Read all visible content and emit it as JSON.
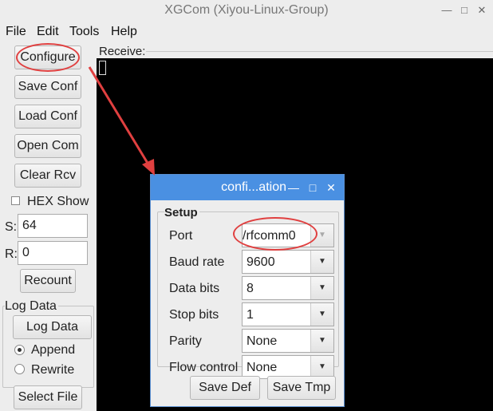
{
  "window": {
    "title": "XGCom (Xiyou-Linux-Group)"
  },
  "menu": [
    "File",
    "Edit",
    "Tools",
    "Help"
  ],
  "buttons": {
    "configure": "Configure",
    "save_conf": "Save Conf",
    "load_conf": "Load Conf",
    "open_com": "Open Com",
    "clear_rcv": "Clear Rcv",
    "recount": "Recount",
    "log_data": "Log Data",
    "select_file": "Select File"
  },
  "hex_show": {
    "label": "HEX Show",
    "checked": false
  },
  "counters": {
    "s_label": "S:",
    "s_value": "64",
    "r_label": "R:",
    "r_value": "0"
  },
  "log": {
    "group_label": "Log Data",
    "append": "Append",
    "rewrite": "Rewrite",
    "selected": "Append"
  },
  "receive": {
    "label": "Receive:"
  },
  "dialog": {
    "title": "confi...ation",
    "group": "Setup",
    "rows": [
      {
        "label": "Port",
        "value": "/rfcomm0"
      },
      {
        "label": "Baud rate",
        "value": "9600"
      },
      {
        "label": "Data bits",
        "value": "8"
      },
      {
        "label": "Stop bits",
        "value": "1"
      },
      {
        "label": "Parity",
        "value": "None"
      },
      {
        "label": "Flow control",
        "value": "None"
      }
    ],
    "save_def": "Save Def",
    "save_tmp": "Save Tmp"
  },
  "colors": {
    "dialog_title_bg": "#4a90e2",
    "annotation": "#e04040",
    "receive_bg": "#000000"
  }
}
